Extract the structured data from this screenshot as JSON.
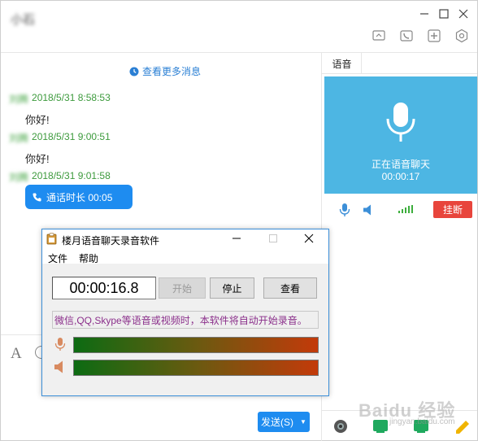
{
  "window": {
    "contact_name": "小石"
  },
  "chat": {
    "more_messages": "查看更多消息",
    "messages": [
      {
        "sender": "刘腾",
        "time": "2018/5/31 8:58:53",
        "text": "你好!"
      },
      {
        "sender": "刘腾",
        "time": "2018/5/31 9:00:51",
        "text": "你好!"
      },
      {
        "sender": "刘腾",
        "time": "2018/5/31 9:01:58",
        "text": ""
      }
    ],
    "call_bubble": "通话时长 00:05",
    "font_icon_label": "A",
    "send_button": "发送(S)"
  },
  "voice_panel": {
    "tab_label": "语音",
    "status": "正在语音聊天",
    "timer": "00:00:17",
    "hangup": "挂断"
  },
  "recorder": {
    "title": "楼月语音聊天录音软件",
    "menu": [
      "文件",
      "帮助"
    ],
    "time": "00:00:16.8",
    "buttons": {
      "start": "开始",
      "stop": "停止",
      "view": "查看"
    },
    "info": "微信,QQ,Skype等语音或视频时，本软件将自动开始录音。"
  },
  "watermark": {
    "main": "Baidu 经验",
    "sub": "jingyan.baidu.com"
  },
  "colors": {
    "accent_blue": "#1e8cf0",
    "voice_card": "#4db6e3",
    "hangup_red": "#e8453c",
    "timestamp_green": "#3c9a3c",
    "info_purple": "#8b2f8b"
  }
}
